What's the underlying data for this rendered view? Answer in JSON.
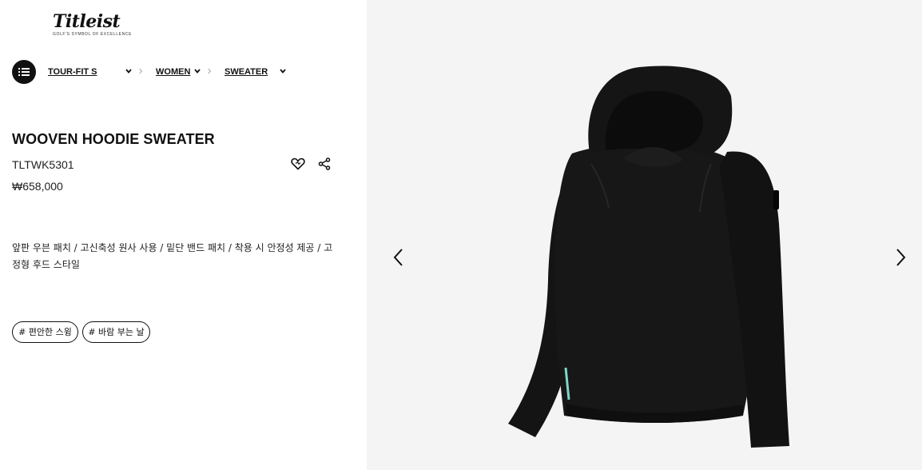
{
  "brand": {
    "logo_text": "Titleist",
    "tagline": "GOLF'S SYMBOL OF EXCELLENCE"
  },
  "breadcrumb": {
    "items": [
      {
        "label": "TOUR-FIT S",
        "has_dropdown": true
      },
      {
        "label": "WOMEN",
        "has_dropdown": true
      },
      {
        "label": "SWEATER",
        "has_dropdown": true
      }
    ]
  },
  "product": {
    "name": "WOOVEN HOODIE SWEATER",
    "sku": "TLTWK5301",
    "price": "₩658,000",
    "description": "앞판 우븐 패치 / 고신축성 원사 사용 / 밑단 밴드 패치 / 착용 시 안정성 제공 / 고정형 후드 스타일",
    "tags": [
      "# 편안한 스윙",
      "# 바람 부는 날"
    ]
  },
  "icons": {
    "menu": "list-menu-icon",
    "wishlist": "heart-icon",
    "share": "share-icon",
    "prev": "chevron-left-icon",
    "next": "chevron-right-icon"
  },
  "colors": {
    "text": "#111111",
    "gallery_bg": "#f4f4f4",
    "garment": "#141414",
    "accent_trim": "#7fd8c4"
  }
}
